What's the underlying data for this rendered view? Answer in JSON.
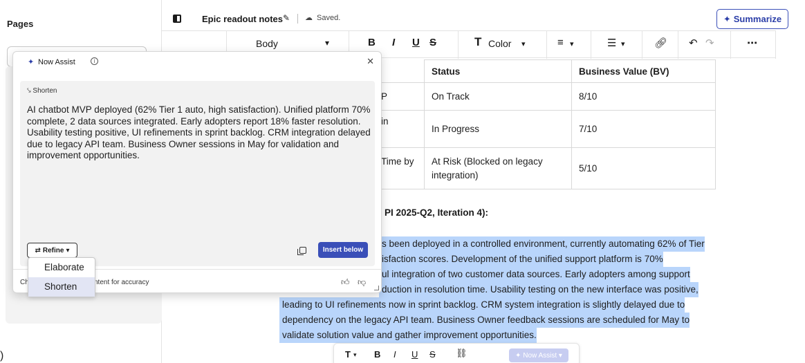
{
  "sidebar": {
    "title": "Pages",
    "stray": ")"
  },
  "header": {
    "doc_title": "Epic readout notes",
    "saved": "Saved.",
    "summarize_label": "Summarize"
  },
  "toolbar": {
    "style_select": "Body",
    "bold": "B",
    "italic": "I",
    "underline": "U",
    "strike": "S",
    "color_label": "Color",
    "text_icon": "T",
    "caret": "▾"
  },
  "table": {
    "headers": [
      "Status",
      "Business Value (BV)"
    ],
    "left_fragments": [
      "P",
      "in",
      "Time by"
    ],
    "rows": [
      {
        "status": "On Track",
        "bv": "8/10"
      },
      {
        "status": "In Progress",
        "bv": "7/10"
      },
      {
        "status": "At Risk (Blocked on legacy integration)",
        "bv": "5/10"
      }
    ]
  },
  "section_heading": "PI 2025-Q2, Iteration 4):",
  "paragraph_lines": [
    "s been deployed in a controlled environment, currently automating 62% of Tier",
    "isfaction scores. Development of the unified support platform is 70%",
    "ul integration of two customer data sources. Early adopters among support",
    "duction in resolution time. Usability testing on the new interface was positive,",
    "leading to UI refinements now in sprint backlog. CRM system integration is slightly delayed due to",
    "dependency on the legacy API team. Business Owner feedback sessions are scheduled for May to",
    "validate solution value and gather improvement opportunities."
  ],
  "float_toolbar": {
    "text_style": "T",
    "bold": "B",
    "italic": "I",
    "underline": "U",
    "strike": "S",
    "assist_label": "Now Assist"
  },
  "assist": {
    "title": "Now Assist",
    "action_label": "Shorten",
    "result_text": "AI chatbot MVP deployed (62% Tier 1 auto, high satisfaction). Unified platform 70% complete, 2 data sources integrated. Early adopters report 18% faster resolution. Usability testing positive, UI refinements in sprint backlog. CRM integration delayed due to legacy API team. Business Owner sessions in May for validation and improvement opportunities.",
    "refine_label": "Refine",
    "insert_label": "Insert below",
    "footer_left": "Ch",
    "footer_right": "ntent for accuracy"
  },
  "refine_menu": {
    "items": [
      "Elaborate",
      "Shorten"
    ],
    "selected": "Shorten"
  },
  "colors": {
    "accent": "#3a4fb8",
    "selection": "#b9d5fb",
    "panel_bg": "#f2f2f2"
  }
}
